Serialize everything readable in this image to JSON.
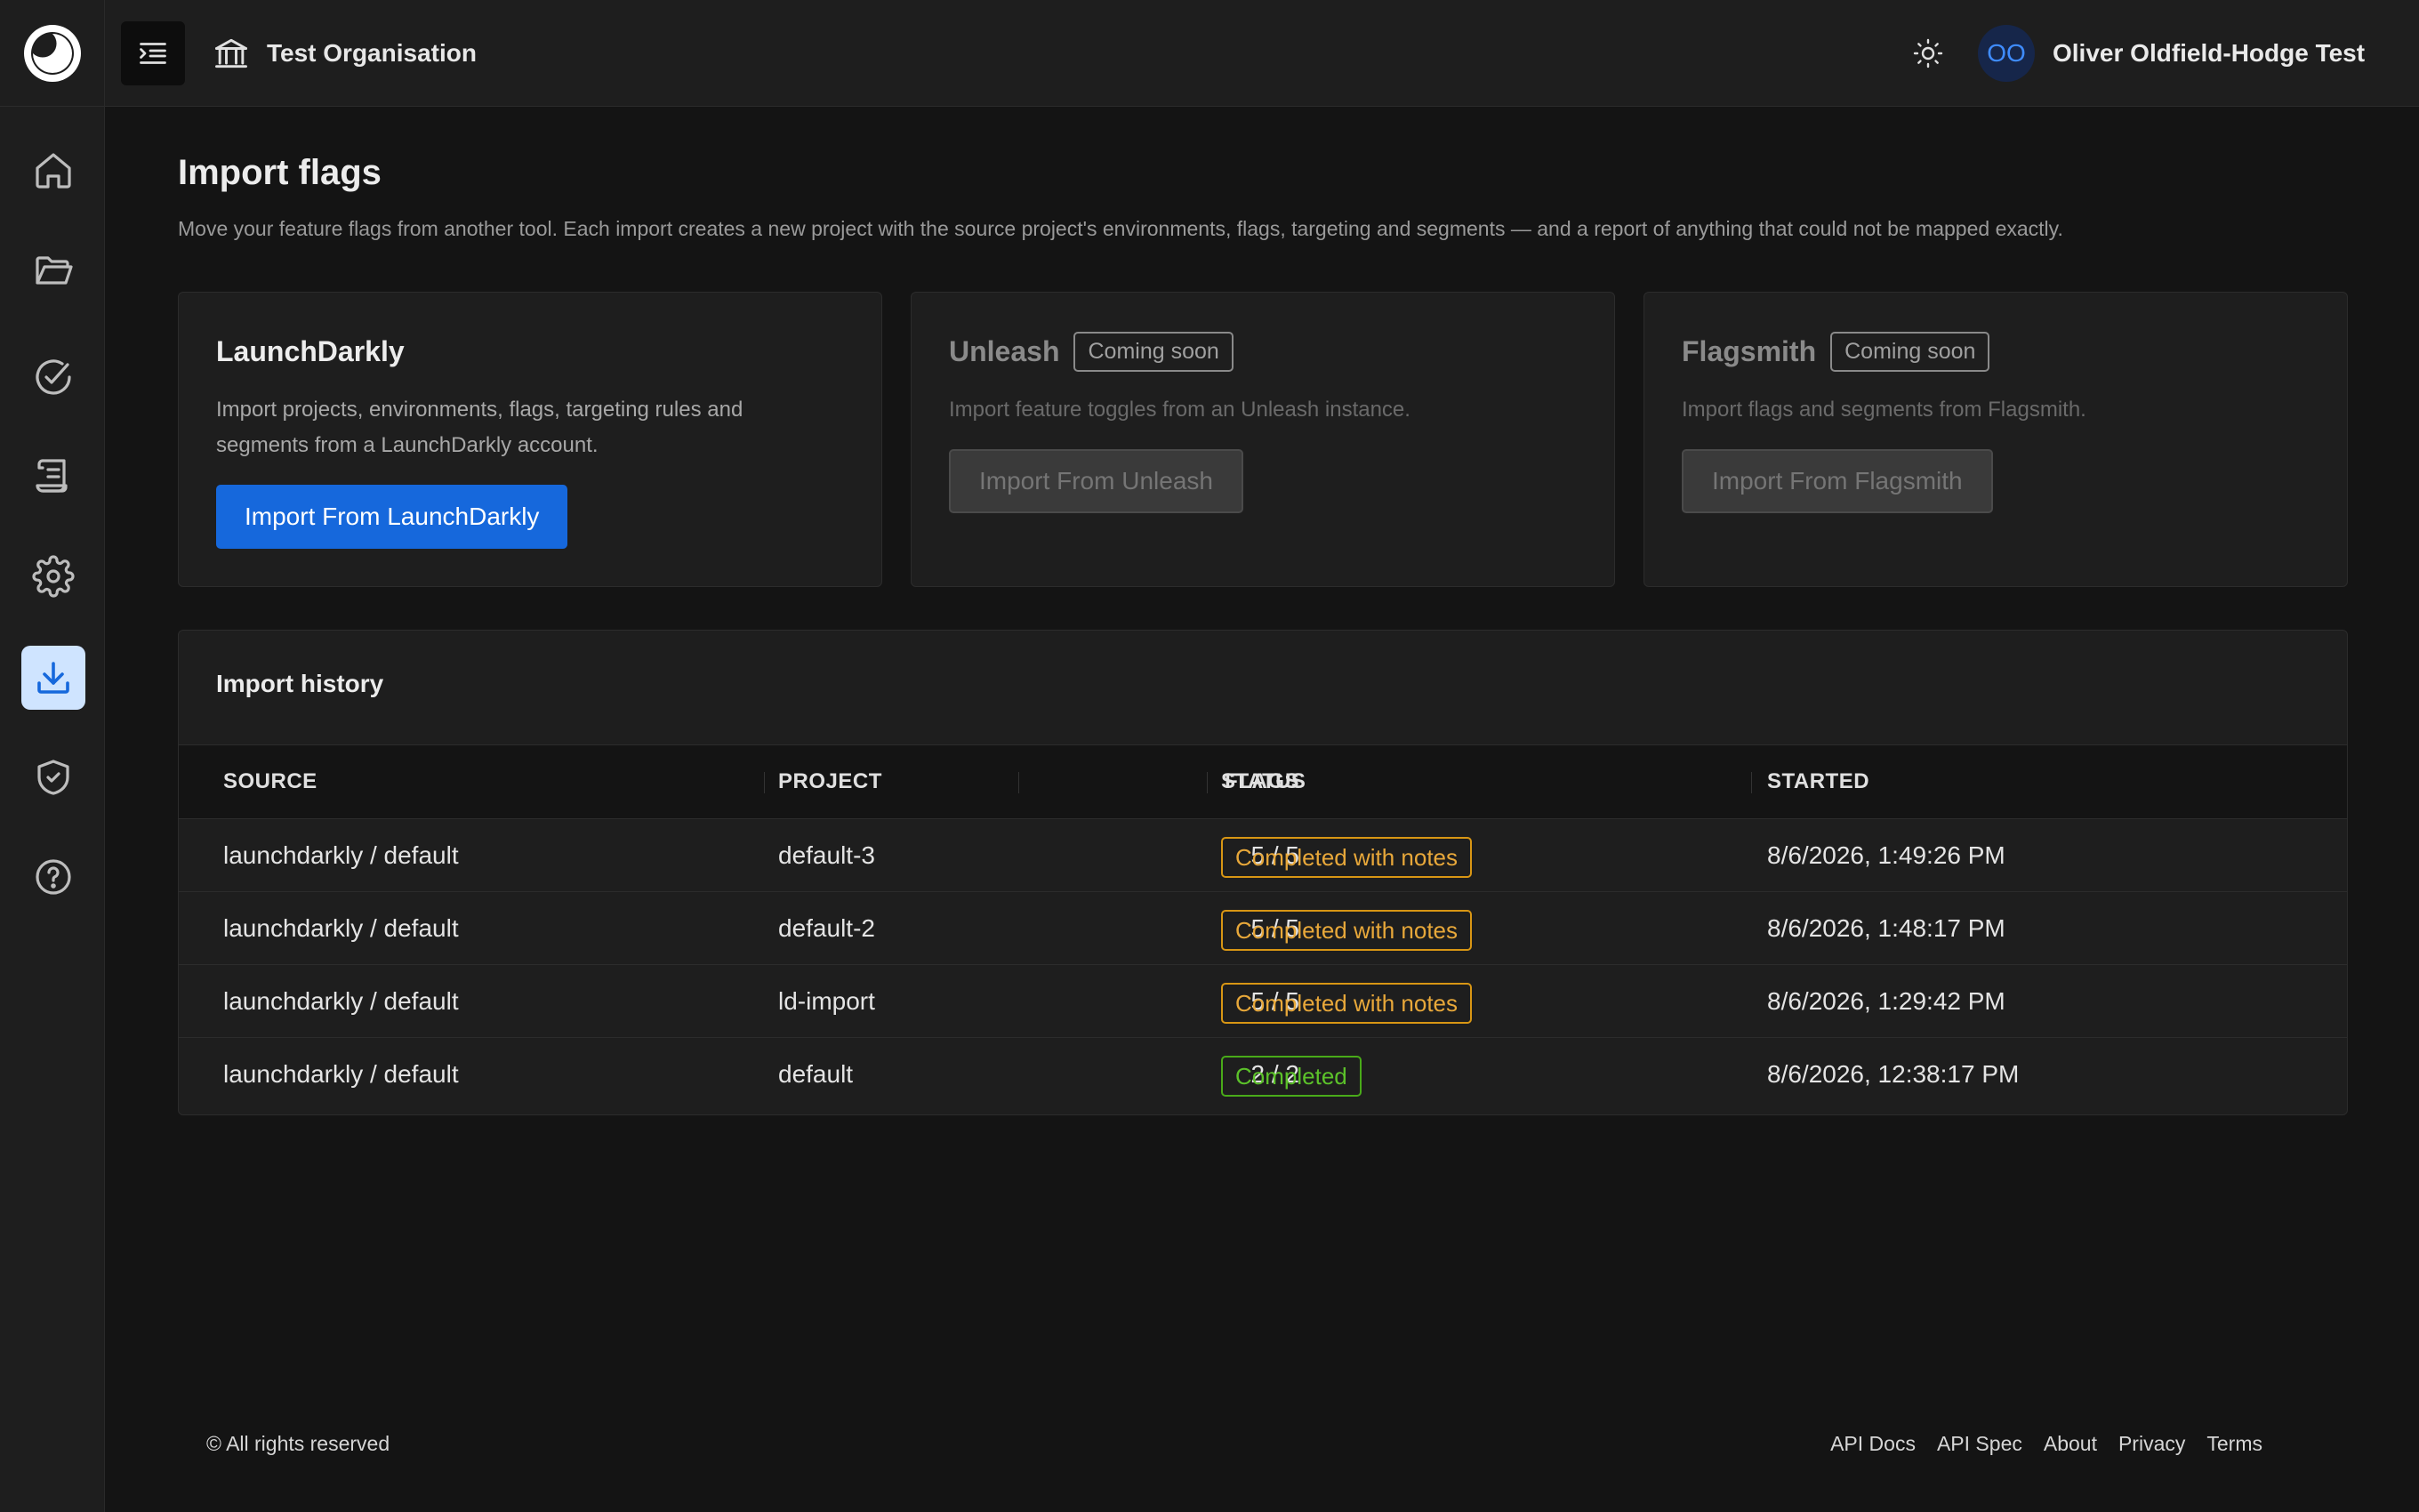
{
  "header": {
    "organisation": "Test Organisation",
    "user": {
      "initials": "OO",
      "name": "Oliver Oldfield-Hodge Test"
    }
  },
  "sidebar": {
    "items": [
      {
        "icon": "home-icon",
        "active": false
      },
      {
        "icon": "folder-icon",
        "active": false
      },
      {
        "icon": "check-circle-icon",
        "active": false
      },
      {
        "icon": "scroll-icon",
        "active": false
      },
      {
        "icon": "gear-icon",
        "active": false
      },
      {
        "icon": "download-icon",
        "active": true
      },
      {
        "icon": "shield-check-icon",
        "active": false
      },
      {
        "icon": "help-circle-icon",
        "active": false
      }
    ]
  },
  "page": {
    "title": "Import flags",
    "description": "Move your feature flags from another tool. Each import creates a new project with the source project's environments, flags, targeting and segments — and a report of anything that could not be mapped exactly."
  },
  "sources": [
    {
      "name": "LaunchDarkly",
      "badge": "",
      "description": "Import projects, environments, flags, targeting rules and segments from a LaunchDarkly account.",
      "button": "Import From LaunchDarkly",
      "enabled": true
    },
    {
      "name": "Unleash",
      "badge": "Coming soon",
      "description": "Import feature toggles from an Unleash instance.",
      "button": "Import From Unleash",
      "enabled": false
    },
    {
      "name": "Flagsmith",
      "badge": "Coming soon",
      "description": "Import flags and segments from Flagsmith.",
      "button": "Import From Flagsmith",
      "enabled": false
    }
  ],
  "history": {
    "title": "Import history",
    "columns": [
      "SOURCE",
      "PROJECT",
      "FLAGS",
      "STATUS",
      "STARTED"
    ],
    "rows": [
      {
        "source": "launchdarkly / default",
        "project": "default-3",
        "flags": "5 / 5",
        "status": "Completed with notes",
        "started": "8/6/2026, 1:49:26 PM"
      },
      {
        "source": "launchdarkly / default",
        "project": "default-2",
        "flags": "5 / 5",
        "status": "Completed with notes",
        "started": "8/6/2026, 1:48:17 PM"
      },
      {
        "source": "launchdarkly / default",
        "project": "ld-import",
        "flags": "5 / 5",
        "status": "Completed with notes",
        "started": "8/6/2026, 1:29:42 PM"
      },
      {
        "source": "launchdarkly / default",
        "project": "default",
        "flags": "2 / 2",
        "status": "Completed",
        "started": "8/6/2026, 12:38:17 PM"
      }
    ]
  },
  "footer": {
    "copyright": "© All rights reserved",
    "links": [
      "API Docs",
      "API Spec",
      "About",
      "Privacy",
      "Terms"
    ]
  },
  "colors": {
    "accent": "#1668dc",
    "status_notes": "#d89614",
    "status_completed": "#49aa19"
  }
}
